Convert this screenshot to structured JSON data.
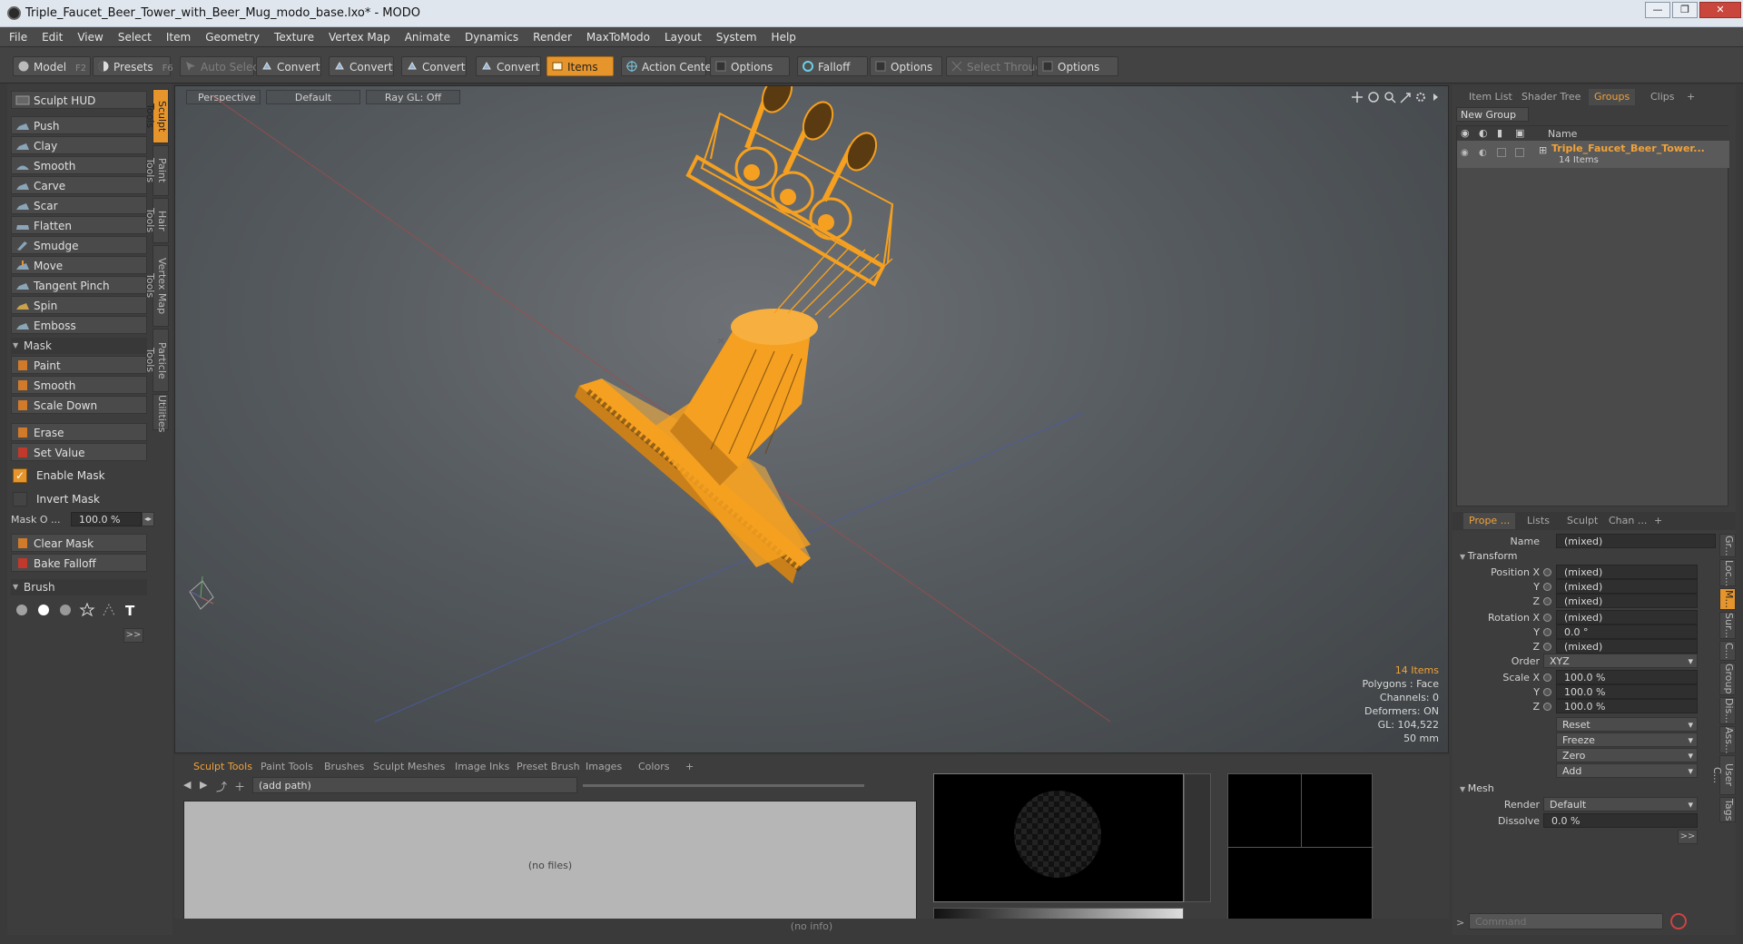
{
  "window": {
    "title": "Triple_Faucet_Beer_Tower_with_Beer_Mug_modo_base.lxo* - MODO"
  },
  "menu": [
    "File",
    "Edit",
    "View",
    "Select",
    "Item",
    "Geometry",
    "Texture",
    "Vertex Map",
    "Animate",
    "Dynamics",
    "Render",
    "MaxToModo",
    "Layout",
    "System",
    "Help"
  ],
  "toolbar": {
    "model": "Model",
    "model_key": "F2",
    "presets": "Presets",
    "presets_key": "F6",
    "auto_select": "Auto Select",
    "convert1": "Convert",
    "convert2": "Convert",
    "convert3": "Convert",
    "convert4": "Convert",
    "items": "Items",
    "action_center": "Action Center",
    "options1": "Options",
    "falloff": "Falloff",
    "options2": "Options",
    "select_through": "Select Through",
    "options3": "Options"
  },
  "sculpt": {
    "hud": "Sculpt HUD",
    "tools": [
      "Push",
      "Clay",
      "Smooth",
      "Carve",
      "Scar",
      "Flatten",
      "Smudge",
      "Move",
      "Tangent Pinch",
      "Spin",
      "Emboss"
    ],
    "mask_header": "Mask",
    "mask_tools": [
      "Paint",
      "Smooth",
      "Scale Down"
    ],
    "erase": "Erase",
    "set_value": "Set Value",
    "enable_mask": "Enable Mask",
    "invert_mask": "Invert Mask",
    "mask_opacity_label": "Mask O ...",
    "mask_opacity_value": "100.0 %",
    "clear_mask": "Clear Mask",
    "bake_falloff": "Bake Falloff",
    "brush_header": "Brush",
    "more": ">>"
  },
  "side_tabs": [
    "Sculpt Tools",
    "Paint Tools",
    "Hair Tools",
    "Vertex Map Tools",
    "Particle Tools",
    "Utilities"
  ],
  "viewport": {
    "tabs": [
      "Perspective",
      "Default",
      "Ray GL: Off"
    ],
    "info": {
      "items": "14 Items",
      "polygons": "Polygons : Face",
      "channels": "Channels: 0",
      "deformers": "Deformers: ON",
      "gl": "GL: 104,522",
      "scale": "50 mm"
    }
  },
  "bottom": {
    "tabs": [
      "Sculpt Tools",
      "Paint Tools",
      "Brushes",
      "Sculpt Meshes",
      "Image Inks",
      "Preset Brush",
      "Images",
      "Colors"
    ],
    "path": "(add path)",
    "no_files": "(no files)",
    "status": "(no info)"
  },
  "groups_panel": {
    "tabs": [
      "Item List",
      "Shader Tree",
      "Groups",
      "Clips"
    ],
    "new_group": "New Group",
    "col_name": "Name",
    "group_name": "Triple_Faucet_Beer_Tower...",
    "group_count": "14 Items"
  },
  "props_panel": {
    "tabs": [
      "Prope ...",
      "Lists",
      "Sculpt",
      "Chan ..."
    ],
    "name_label": "Name",
    "name_value": "(mixed)",
    "transform": "Transform",
    "position_x": "Position X",
    "pos_x": "(mixed)",
    "y": "Y",
    "pos_y": "(mixed)",
    "z": "Z",
    "pos_z": "(mixed)",
    "rotation_x": "Rotation X",
    "rot_x": "(mixed)",
    "rot_y": "0.0 °",
    "rot_z": "(mixed)",
    "order_label": "Order",
    "order": "XYZ",
    "scale_x": "Scale X",
    "scl_x": "100.0 %",
    "scl_y": "100.0 %",
    "scl_z": "100.0 %",
    "reset": "Reset",
    "freeze": "Freeze",
    "zero": "Zero",
    "add": "Add",
    "mesh": "Mesh",
    "render_label": "Render",
    "render": "Default",
    "dissolve_label": "Dissolve",
    "dissolve": "0.0 %",
    "more": ">>",
    "side_tabs": [
      "Gr...",
      "Loc...",
      "M...",
      "Sur...",
      "C...",
      "Group",
      "Dis...",
      "Ass...",
      "User C...",
      "Tags"
    ]
  },
  "command": {
    "placeholder": "Command"
  },
  "colors": {
    "accent": "#e6952c",
    "mesh": "#f5a020"
  }
}
